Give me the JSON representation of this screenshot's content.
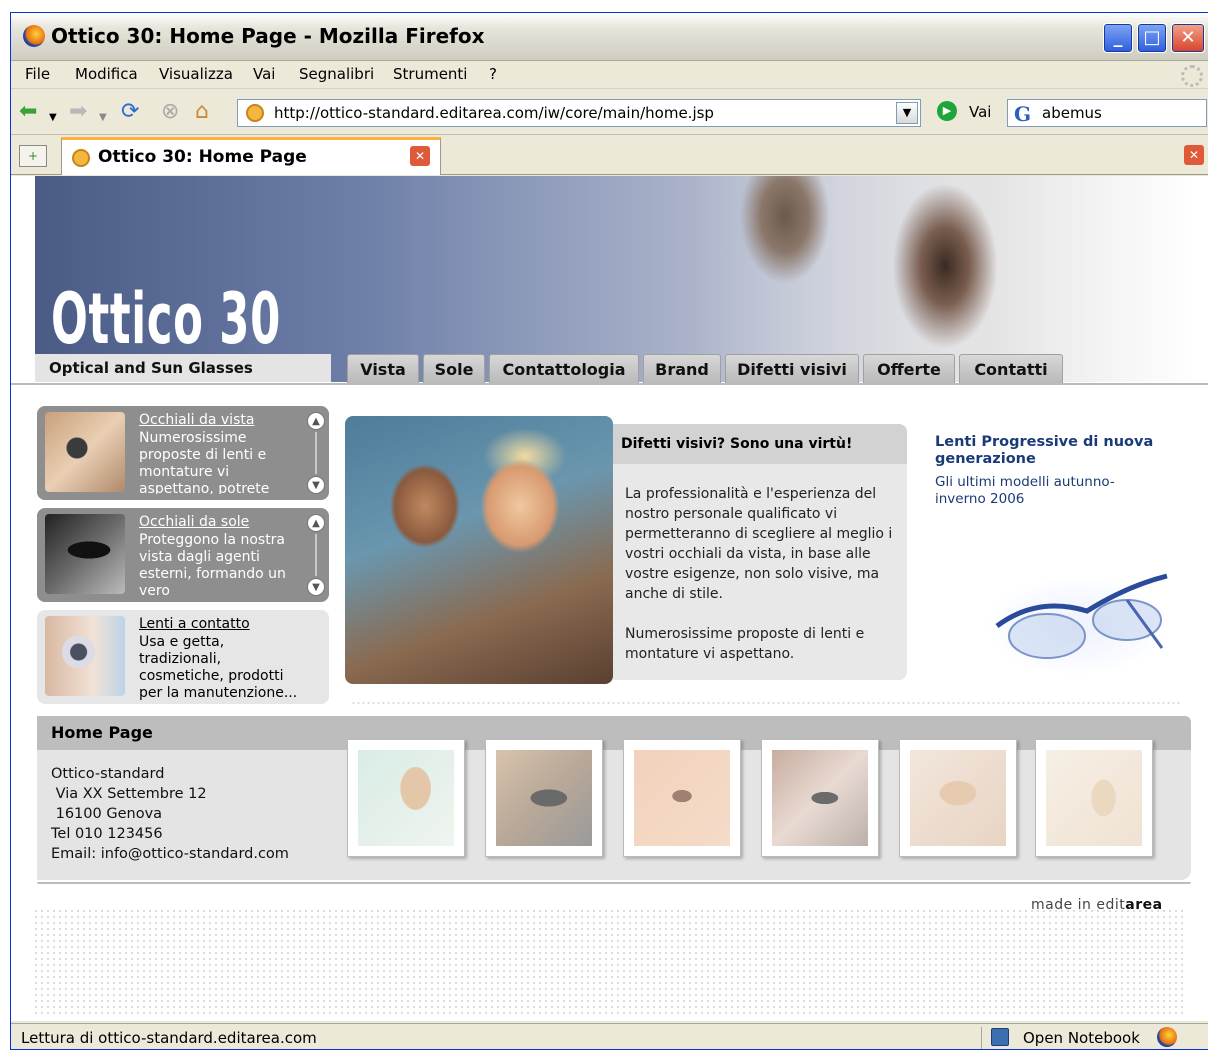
{
  "window": {
    "title": "Ottico 30: Home Page - Mozilla Firefox"
  },
  "menubar": {
    "items": [
      "File",
      "Modifica",
      "Visualizza",
      "Vai",
      "Segnalibri",
      "Strumenti",
      "?"
    ]
  },
  "navbar": {
    "url": "http://ottico-standard.editarea.com/iw/core/main/home.jsp",
    "go_label": "Vai",
    "search_value": "abemus"
  },
  "tab": {
    "label": "Ottico 30: Home Page"
  },
  "site": {
    "logo": "Ottico 30",
    "tagline": "Optical and Sun Glasses",
    "nav": [
      "Vista",
      "Sole",
      "Contattologia",
      "Brand",
      "Difetti visivi",
      "Offerte",
      "Contatti"
    ],
    "sidebar": [
      {
        "title": "Occhiali da vista",
        "desc": "Numerosissime proposte di lenti e montature vi aspettano, potrete"
      },
      {
        "title": "Occhiali da sole",
        "desc": "Proteggono la nostra vista dagli agenti esterni, formando un vero"
      },
      {
        "title": "Lenti a contatto",
        "desc": "Usa e getta, tradizionali, cosmetiche, prodotti per la manutenzione..."
      }
    ],
    "promo": {
      "title": "Difetti visivi? Sono una virtù!",
      "p1": "La professionalità e l'esperienza del nostro personale qualificato vi permetteranno di scegliere al meglio i vostri occhiali da vista, in base alle vostre esigenze, non solo visive, ma anche di stile.",
      "p2": "Numerosissime proposte di lenti e montature vi aspettano."
    },
    "right": {
      "title": "Lenti Progressive di nuova generazione",
      "subtitle": "Gli ultimi modelli autunno-inverno 2006"
    },
    "home_label": "Home Page",
    "address": "Ottico-standard\n Via XX Settembre 12\n 16100 Genova\nTel 010 123456\nEmail: info@ottico-standard.com",
    "made_in_prefix": "made in edit",
    "made_in_brand": "area"
  },
  "status": {
    "text": "Lettura di ottico-standard.editarea.com",
    "notebook": "Open Notebook"
  },
  "colors": {
    "accent_tab": "#ffb13b",
    "header_blue": "#4a5c86",
    "link_blue": "#1a3a78"
  }
}
